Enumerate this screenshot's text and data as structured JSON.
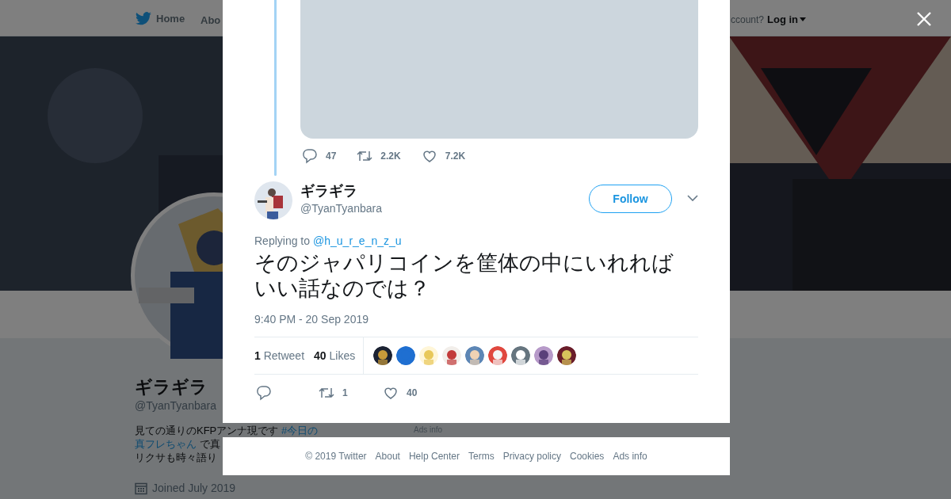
{
  "background_page": {
    "nav": {
      "items": [
        "Home",
        "Abo"
      ],
      "login_prompt": "ccount?",
      "login": "Log in"
    },
    "profile": {
      "name": "ギラギラ",
      "handle": "@TyanTyanbara",
      "bio": [
        [
          {
            "text": "見ての通りのKFPアンナ現です ",
            "link": false
          },
          {
            "text": "#今日の",
            "link": true
          }
        ],
        [
          {
            "text": "真フレちゃん",
            "link": true
          },
          {
            "text": " で真",
            "link": false
          }
        ],
        [
          {
            "text": "リクサも時々語り",
            "link": false
          }
        ]
      ],
      "joined": "Joined July 2019"
    },
    "sidebar_text": "Ads info"
  },
  "modal": {
    "parent_tweet": {
      "media": {
        "kind": "placeholder"
      },
      "replies": "47",
      "retweets": "2.2K",
      "likes": "7.2K"
    },
    "tweet": {
      "name": "ギラギラ",
      "handle": "@TyanTyanbara",
      "follow_button": "Follow",
      "replying_label": "Replying to",
      "replying_to": "@h_u_r_e_n_z_u",
      "text": "そのジャパリコインを筐体の中にいれればいい話なのでは？",
      "timestamp": "9:40 PM - 20 Sep 2019",
      "retweet_count": "1",
      "retweet_label": "Retweet",
      "like_count": "40",
      "like_label": "Likes",
      "actions": {
        "retweets": "1",
        "likes": "40"
      }
    },
    "footer": [
      "© 2019 Twitter",
      "About",
      "Help Center",
      "Terms",
      "Privacy policy",
      "Cookies",
      "Ads info"
    ]
  }
}
